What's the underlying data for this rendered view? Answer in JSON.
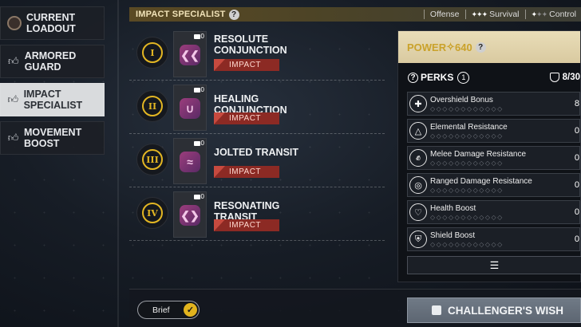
{
  "loadouts": [
    {
      "label": "CURRENT LOADOUT",
      "icon": "avatar-icon",
      "active": false
    },
    {
      "label": "ARMORED GUARD",
      "icon": "thumbs-up-icon",
      "active": false
    },
    {
      "label": "IMPACT SPECIALIST",
      "icon": "thumbs-up-icon",
      "active": true
    },
    {
      "label": "MOVEMENT BOOST",
      "icon": "thumbs-up-icon",
      "active": false
    }
  ],
  "header": {
    "title": "IMPACT SPECIALIST",
    "stats": [
      {
        "label": "Offense",
        "filled": 3,
        "total": 3
      },
      {
        "label": "Survival",
        "filled": 1,
        "total": 3
      },
      {
        "label": "Control",
        "filled": 0,
        "total": 0
      }
    ]
  },
  "mods": [
    {
      "tier": "I",
      "name": "RESOLUTE CONJUNCTION",
      "energy": "0",
      "tag": "IMPACT"
    },
    {
      "tier": "II",
      "name": "HEALING CONJUNCTION",
      "energy": "0",
      "tag": "IMPACT"
    },
    {
      "tier": "III",
      "name": "JOLTED TRANSIT",
      "energy": "0",
      "tag": "IMPACT"
    },
    {
      "tier": "IV",
      "name": "RESONATING TRANSIT",
      "energy": "0",
      "tag": "IMPACT"
    }
  ],
  "panel": {
    "power_label": "POWER",
    "power_value": "640",
    "perks_title": "PERKS",
    "perks_count": "1",
    "slots": "8/30",
    "perks": [
      {
        "name": "Overshield Bonus",
        "value": "8",
        "icon": "shield-plus-icon"
      },
      {
        "name": "Elemental Resistance",
        "value": "0",
        "icon": "element-icon"
      },
      {
        "name": "Melee Damage Resistance",
        "value": "0",
        "icon": "fist-icon"
      },
      {
        "name": "Ranged Damage Resistance",
        "value": "0",
        "icon": "target-icon"
      },
      {
        "name": "Health Boost",
        "value": "0",
        "icon": "heart-icon"
      },
      {
        "name": "Shield Boost",
        "value": "0",
        "icon": "shield-icon"
      }
    ]
  },
  "bottom": {
    "brief_label": "Brief",
    "wish_label": "CHALLENGER'S WISH"
  }
}
